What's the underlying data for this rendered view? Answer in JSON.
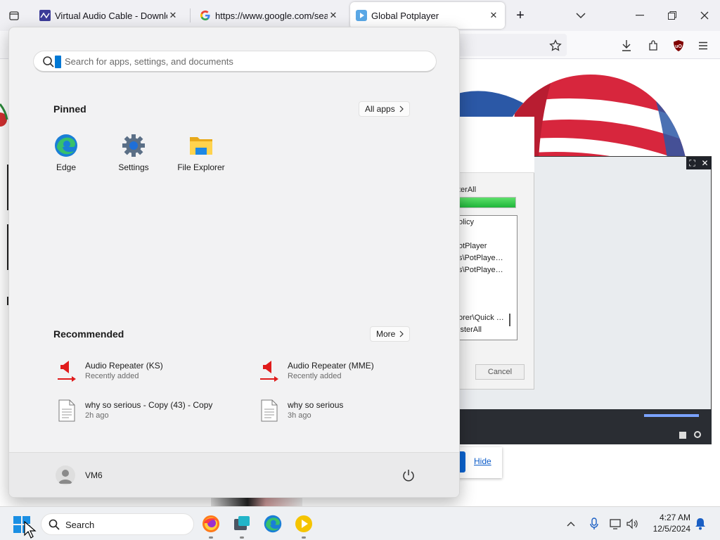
{
  "browser": {
    "tabs": [
      {
        "title": "Virtual Audio Cable - Download",
        "icon": "vac-icon"
      },
      {
        "title": "https://www.google.com/searc",
        "icon": "google-icon"
      },
      {
        "title": "Global Potplayer",
        "icon": "potplayer-icon",
        "active": true
      }
    ]
  },
  "background": {
    "installer_lines": [
      "terAll",
      "olicy",
      "otPlayer",
      "s\\PotPlaye…",
      "s\\PotPlaye…",
      "orer\\Quick …",
      "isterAll"
    ],
    "cancel_label": "Cancel",
    "hide_label": "Hide"
  },
  "start_menu": {
    "search_placeholder": "Search for apps, settings, and documents",
    "pinned_title": "Pinned",
    "all_apps_label": "All apps",
    "pinned": [
      {
        "label": "Edge",
        "icon": "edge-icon"
      },
      {
        "label": "Settings",
        "icon": "settings-gear-icon"
      },
      {
        "label": "File Explorer",
        "icon": "folder-icon"
      }
    ],
    "recommended_title": "Recommended",
    "more_label": "More",
    "recommended": [
      {
        "title": "Audio Repeater (KS)",
        "subtitle": "Recently added",
        "icon": "audio-repeater-icon"
      },
      {
        "title": "Audio Repeater (MME)",
        "subtitle": "Recently added",
        "icon": "audio-repeater-icon"
      },
      {
        "title": "why so serious - Copy (43) - Copy",
        "subtitle": "2h ago",
        "icon": "document-icon"
      },
      {
        "title": "why so serious",
        "subtitle": "3h ago",
        "icon": "document-icon"
      }
    ],
    "user_name": "VM6"
  },
  "taskbar": {
    "search_label": "Search",
    "time": "4:27 AM",
    "date": "12/5/2024",
    "apps": [
      "firefox-icon",
      "app-icon",
      "edge-icon",
      "potplayer-icon"
    ]
  },
  "colors": {
    "accent": "#0078d4",
    "installer_progress": "#1fb53a",
    "audio_repeater_red": "#e01b1b"
  }
}
